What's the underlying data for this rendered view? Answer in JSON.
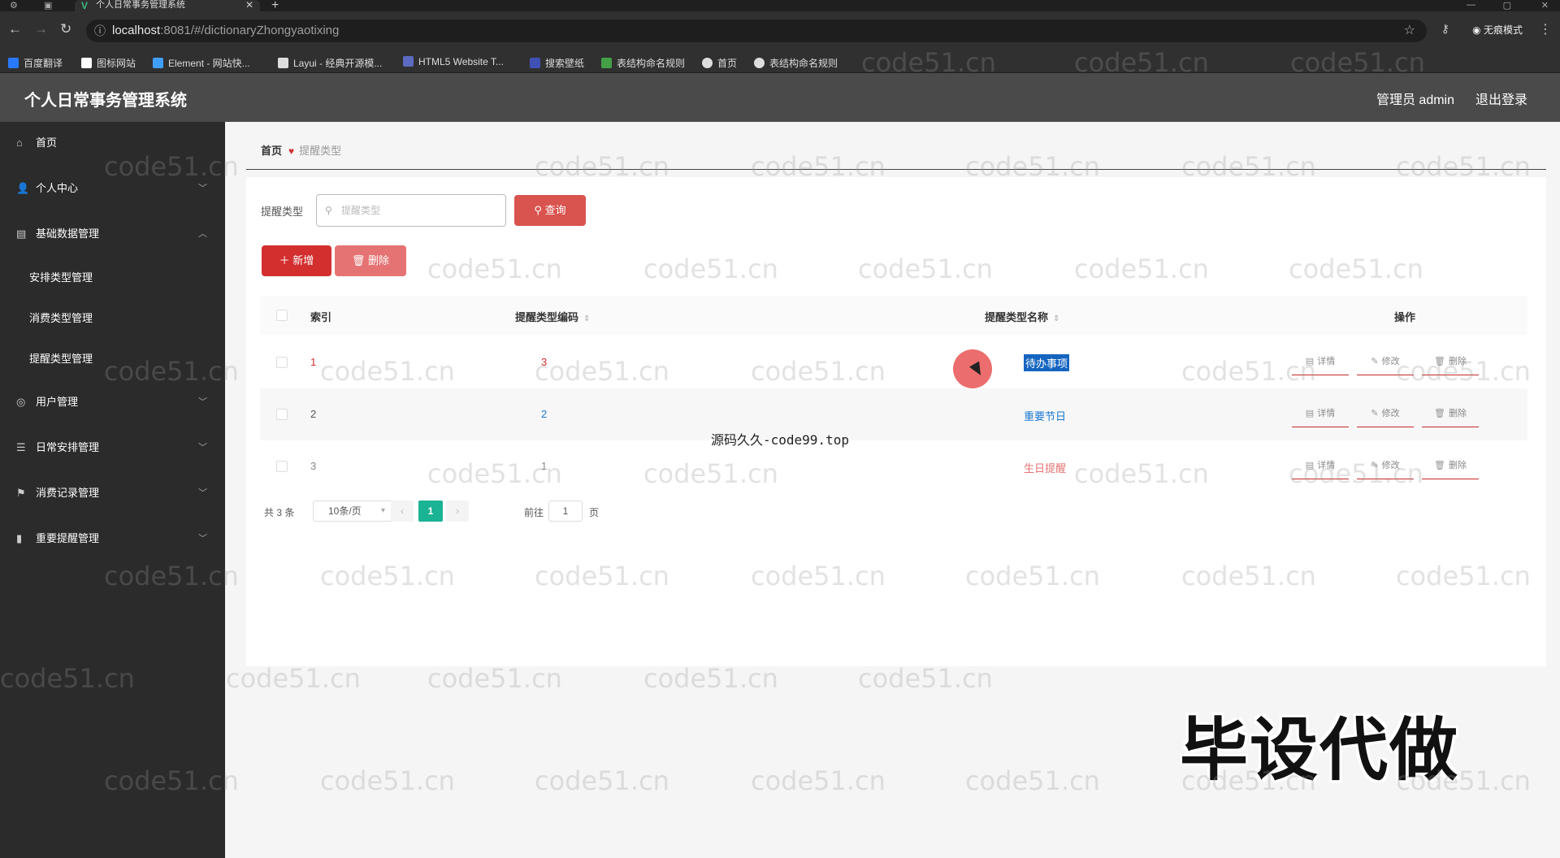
{
  "browser": {
    "tab_title": "个人日常事务管理系统",
    "url_host": "localhost",
    "url_path": ":8081/#/dictionaryZhongyaotixing",
    "incognito_label": "无痕模式",
    "bookmarks": [
      {
        "label": "百度翻译",
        "color": "#2979ff"
      },
      {
        "label": "图标网站",
        "color": "#ffffff"
      },
      {
        "label": "Element - 网站快...",
        "color": "#409eff"
      },
      {
        "label": "Layui - 经典开源模...",
        "color": "#dddddd"
      },
      {
        "label": "HTML5 Website T...",
        "color": "#5c6bc0"
      },
      {
        "label": "搜索壁纸",
        "color": "#3f51b5"
      },
      {
        "label": "表结构命名规则",
        "color": "#43a047"
      },
      {
        "label": "首页",
        "color": "#dddddd"
      },
      {
        "label": "表结构命名规则",
        "color": "#dddddd"
      }
    ]
  },
  "header": {
    "title": "个人日常事务管理系统",
    "user": "管理员 admin",
    "logout": "退出登录"
  },
  "sidebar": {
    "items": [
      {
        "label": "首页",
        "icon": "home-icon",
        "glyph": "⌂"
      },
      {
        "label": "个人中心",
        "icon": "user-icon",
        "glyph": "👤",
        "chevron": "﹀"
      },
      {
        "label": "基础数据管理",
        "icon": "data-icon",
        "glyph": "▤",
        "chevron": "︿"
      },
      {
        "label": "用户管理",
        "icon": "users-icon",
        "glyph": "◎",
        "chevron": "﹀"
      },
      {
        "label": "日常安排管理",
        "icon": "list-icon",
        "glyph": "☰",
        "chevron": "﹀"
      },
      {
        "label": "消费记录管理",
        "icon": "flag-icon",
        "glyph": "⚑",
        "chevron": "﹀"
      },
      {
        "label": "重要提醒管理",
        "icon": "bar-chart-icon",
        "glyph": "▮",
        "chevron": "﹀"
      }
    ],
    "sub_items": [
      "安排类型管理",
      "消费类型管理",
      "提醒类型管理"
    ]
  },
  "breadcrumb": {
    "home": "首页",
    "current": "提醒类型"
  },
  "search": {
    "label": "提醒类型",
    "placeholder": "提醒类型",
    "button": "查询"
  },
  "actions": {
    "add": "新增",
    "delete": "删除"
  },
  "table": {
    "columns": [
      "索引",
      "提醒类型编码",
      "提醒类型名称",
      "操作"
    ],
    "rows": [
      {
        "index": "1",
        "code": "3",
        "name": "待办事项"
      },
      {
        "index": "2",
        "code": "2",
        "name": "重要节日"
      },
      {
        "index": "3",
        "code": "1",
        "name": "生日提醒"
      }
    ],
    "ops": {
      "detail": "详情",
      "edit": "修改",
      "delete": "删除"
    }
  },
  "pagination": {
    "total": "共 3 条",
    "page_size": "10条/页",
    "current": "1",
    "goto_label": "前往",
    "goto_value": "1",
    "goto_unit": "页"
  },
  "overlays": {
    "source_text": "源码久久-code99.top",
    "big_text": "毕设代做",
    "watermark": "code51.cn"
  },
  "colors": {
    "accent": "#d32f2f",
    "pager_active": "#1ab394",
    "sidebar_bg": "#2b2b2b",
    "header_bg": "#4a4a4a"
  }
}
